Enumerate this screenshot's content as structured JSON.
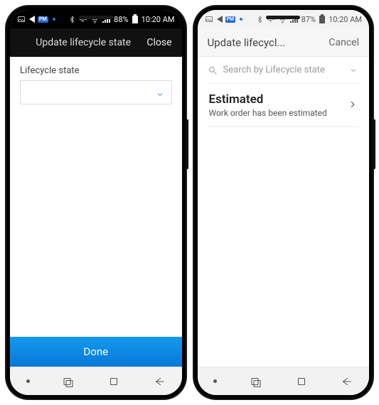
{
  "left": {
    "statusbar": {
      "battery_pct": "88%",
      "time": "10:20 AM"
    },
    "header": {
      "title": "Update lifecycle state",
      "close": "Close"
    },
    "form": {
      "field_label": "Lifecycle state",
      "selected_value": ""
    },
    "footer": {
      "done": "Done"
    }
  },
  "right": {
    "statusbar": {
      "battery_pct": "87%",
      "time": "10:20 AM"
    },
    "header": {
      "title": "Update lifecycl...",
      "cancel": "Cancel"
    },
    "search": {
      "placeholder": "Search by Lifecycle state"
    },
    "items": [
      {
        "title": "Estimated",
        "subtitle": "Work order has been estimated"
      }
    ]
  },
  "icons": {
    "bluetooth": "bluetooth",
    "mute": "mute",
    "wifi": "wifi",
    "signal": "signal",
    "battery": "battery",
    "image": "image",
    "play": "play",
    "recents": "recents",
    "home": "home",
    "back": "back"
  }
}
